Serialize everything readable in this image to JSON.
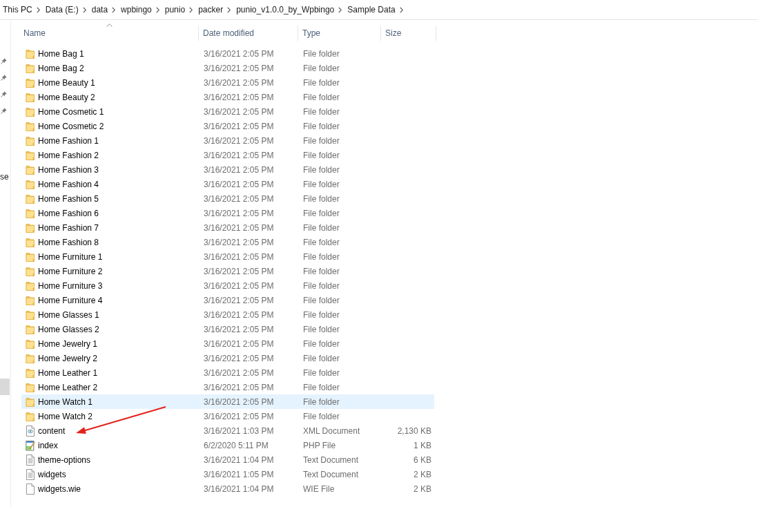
{
  "breadcrumb": [
    "This PC",
    "Data (E:)",
    "data",
    "wpbingo",
    "punio",
    "packer",
    "punio_v1.0.0_by_Wpbingo",
    "Sample Data"
  ],
  "navigation_pane": {
    "items": [
      {
        "pinned": true,
        "selected": false
      },
      {
        "pinned": true,
        "selected": false
      },
      {
        "pinned": true,
        "selected": false
      },
      {
        "pinned": true,
        "selected": false
      },
      {
        "label": "se",
        "pinned": false,
        "selected": false
      },
      {
        "pinned": false,
        "selected": true
      }
    ]
  },
  "columns": [
    {
      "label": "Name",
      "sorted": true
    },
    {
      "label": "Date modified",
      "sorted": false
    },
    {
      "label": "Type",
      "sorted": false
    },
    {
      "label": "Size",
      "sorted": false
    }
  ],
  "rows": [
    {
      "kind": "folder",
      "name": "Home Bag 1",
      "date_modified": "3/16/2021 2:05 PM",
      "type": "File folder",
      "highlighted": false
    },
    {
      "kind": "folder",
      "name": "Home Bag 2",
      "date_modified": "3/16/2021 2:05 PM",
      "type": "File folder",
      "highlighted": false
    },
    {
      "kind": "folder",
      "name": "Home Beauty 1",
      "date_modified": "3/16/2021 2:05 PM",
      "type": "File folder",
      "highlighted": false
    },
    {
      "kind": "folder",
      "name": "Home Beauty 2",
      "date_modified": "3/16/2021 2:05 PM",
      "type": "File folder",
      "highlighted": false
    },
    {
      "kind": "folder",
      "name": "Home Cosmetic 1",
      "date_modified": "3/16/2021 2:05 PM",
      "type": "File folder",
      "highlighted": false
    },
    {
      "kind": "folder",
      "name": "Home Cosmetic 2",
      "date_modified": "3/16/2021 2:05 PM",
      "type": "File folder",
      "highlighted": false
    },
    {
      "kind": "folder",
      "name": "Home Fashion 1",
      "date_modified": "3/16/2021 2:05 PM",
      "type": "File folder",
      "highlighted": false
    },
    {
      "kind": "folder",
      "name": "Home Fashion 2",
      "date_modified": "3/16/2021 2:05 PM",
      "type": "File folder",
      "highlighted": false
    },
    {
      "kind": "folder",
      "name": "Home Fashion 3",
      "date_modified": "3/16/2021 2:05 PM",
      "type": "File folder",
      "highlighted": false
    },
    {
      "kind": "folder",
      "name": "Home Fashion 4",
      "date_modified": "3/16/2021 2:05 PM",
      "type": "File folder",
      "highlighted": false
    },
    {
      "kind": "folder",
      "name": "Home Fashion 5",
      "date_modified": "3/16/2021 2:05 PM",
      "type": "File folder",
      "highlighted": false
    },
    {
      "kind": "folder",
      "name": "Home Fashion 6",
      "date_modified": "3/16/2021 2:05 PM",
      "type": "File folder",
      "highlighted": false
    },
    {
      "kind": "folder",
      "name": "Home Fashion 7",
      "date_modified": "3/16/2021 2:05 PM",
      "type": "File folder",
      "highlighted": false
    },
    {
      "kind": "folder",
      "name": "Home Fashion 8",
      "date_modified": "3/16/2021 2:05 PM",
      "type": "File folder",
      "highlighted": false
    },
    {
      "kind": "folder",
      "name": "Home Furniture 1",
      "date_modified": "3/16/2021 2:05 PM",
      "type": "File folder",
      "highlighted": false
    },
    {
      "kind": "folder",
      "name": "Home Furniture 2",
      "date_modified": "3/16/2021 2:05 PM",
      "type": "File folder",
      "highlighted": false
    },
    {
      "kind": "folder",
      "name": "Home Furniture 3",
      "date_modified": "3/16/2021 2:05 PM",
      "type": "File folder",
      "highlighted": false
    },
    {
      "kind": "folder",
      "name": "Home Furniture 4",
      "date_modified": "3/16/2021 2:05 PM",
      "type": "File folder",
      "highlighted": false
    },
    {
      "kind": "folder",
      "name": "Home Glasses 1",
      "date_modified": "3/16/2021 2:05 PM",
      "type": "File folder",
      "highlighted": false
    },
    {
      "kind": "folder",
      "name": "Home Glasses 2",
      "date_modified": "3/16/2021 2:05 PM",
      "type": "File folder",
      "highlighted": false
    },
    {
      "kind": "folder",
      "name": "Home Jewelry 1",
      "date_modified": "3/16/2021 2:05 PM",
      "type": "File folder",
      "highlighted": false
    },
    {
      "kind": "folder",
      "name": "Home Jewelry 2",
      "date_modified": "3/16/2021 2:05 PM",
      "type": "File folder",
      "highlighted": false
    },
    {
      "kind": "folder",
      "name": "Home Leather 1",
      "date_modified": "3/16/2021 2:05 PM",
      "type": "File folder",
      "highlighted": false
    },
    {
      "kind": "folder",
      "name": "Home Leather 2",
      "date_modified": "3/16/2021 2:05 PM",
      "type": "File folder",
      "highlighted": false
    },
    {
      "kind": "folder",
      "name": "Home Watch 1",
      "date_modified": "3/16/2021 2:05 PM",
      "type": "File folder",
      "highlighted": true
    },
    {
      "kind": "folder",
      "name": "Home Watch 2",
      "date_modified": "3/16/2021 2:05 PM",
      "type": "File folder",
      "highlighted": false
    },
    {
      "kind": "xml",
      "name": "content",
      "date_modified": "3/16/2021 1:03 PM",
      "type": "XML Document",
      "size": "2,130 KB",
      "highlighted": false
    },
    {
      "kind": "php",
      "name": "index",
      "date_modified": "6/2/2020 5:11 PM",
      "type": "PHP File",
      "size": "1 KB",
      "highlighted": false
    },
    {
      "kind": "text",
      "name": "theme-options",
      "date_modified": "3/16/2021 1:04 PM",
      "type": "Text Document",
      "size": "6 KB",
      "highlighted": false
    },
    {
      "kind": "text",
      "name": "widgets",
      "date_modified": "3/16/2021 1:05 PM",
      "type": "Text Document",
      "size": "2 KB",
      "highlighted": false
    },
    {
      "kind": "file",
      "name": "widgets.wie",
      "date_modified": "3/16/2021 1:04 PM",
      "type": "WIE File",
      "size": "2 KB",
      "highlighted": false
    }
  ]
}
